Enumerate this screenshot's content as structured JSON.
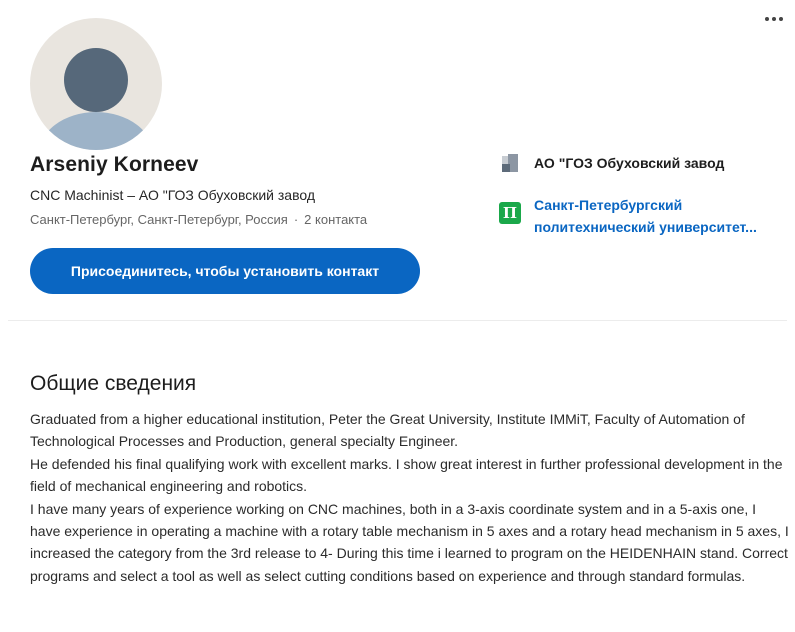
{
  "profile": {
    "name": "Arseniy Korneev",
    "headline": "CNC Machinist – АО \"ГОЗ Обуховский завод",
    "location": "Санкт-Петербург, Санкт-Петербург, Россия",
    "separator": "·",
    "connections": "2 контакта",
    "connect_label": "Присоединитесь, чтобы установить контакт",
    "avatar_icon": "default-avatar-icon",
    "more_icon": "more-dots-icon"
  },
  "experience": {
    "company": "АО \"ГОЗ Обуховский завод",
    "logo_icon": "company-logo-icon"
  },
  "education": {
    "school": "Санкт-Петербургский политехнический университет...",
    "logo_glyph": "Π",
    "logo_icon": "school-logo-icon"
  },
  "about": {
    "title": "Общие сведения",
    "paragraphs": [
      "Graduated from a higher educational institution, Peter the Great University, Institute IMMiT, Faculty of Automation of Technological Processes and Production, general specialty Engineer.",
      "He defended his final qualifying work with excellent marks. I show great interest in further professional development in the field of mechanical engineering and robotics.",
      "I have many years of experience working on CNC machines, both in a 3-axis coordinate system and in a 5-axis one, I have experience in operating a machine with a rotary table mechanism in 5 axes and a rotary head mechanism in 5 axes, I increased the category from the 3rd release to 4- During this time i learned to program on the HEIDENHAIN stand. Correct programs and select a tool as well as select cutting conditions based on experience and through standard formulas."
    ]
  },
  "colors": {
    "accent": "#0a66c2",
    "school_logo": "#1aa84a"
  }
}
